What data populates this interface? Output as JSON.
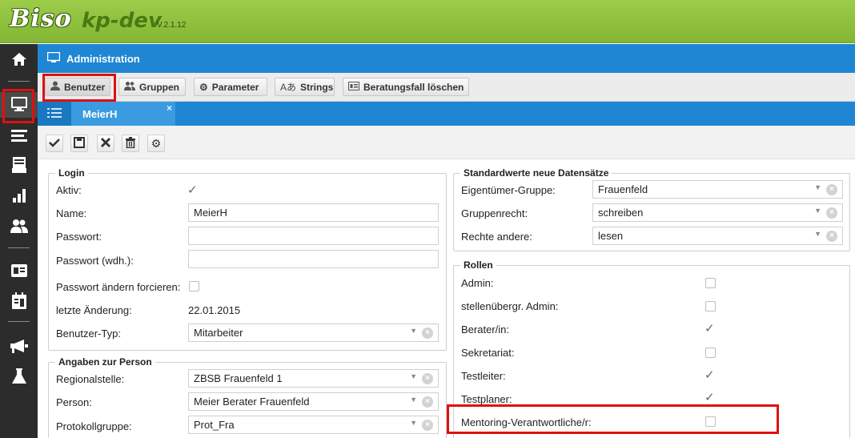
{
  "header": {
    "logo": "Biso",
    "app_name": "kp-dev",
    "version": "V.2.1.12"
  },
  "sidebar": {
    "items": [
      {
        "icon": "home-icon"
      },
      {
        "icon": "monitor-icon",
        "active": true
      },
      {
        "icon": "list-icon"
      },
      {
        "icon": "archive-icon"
      },
      {
        "icon": "bar-chart-icon"
      },
      {
        "icon": "users-icon"
      },
      {
        "icon": "id-card-icon"
      },
      {
        "icon": "calendar-icon"
      },
      {
        "icon": "megaphone-icon"
      },
      {
        "icon": "flask-icon"
      }
    ]
  },
  "admin_bar": {
    "title": "Administration"
  },
  "admin_toolbar": {
    "buttons": [
      {
        "label": "Benutzer",
        "icon": "user-icon",
        "active": true
      },
      {
        "label": "Gruppen",
        "icon": "group-icon"
      },
      {
        "label": "Parameter",
        "icon": "gear-icon"
      },
      {
        "label": "Strings",
        "icon": "translate-icon"
      },
      {
        "label": "Beratungsfall löschen",
        "icon": "card-icon"
      }
    ]
  },
  "tabs": [
    {
      "label": "MeierH",
      "close": "×"
    }
  ],
  "form_toolbar": {
    "buttons": [
      "save-check",
      "save-disk",
      "cancel",
      "delete",
      "settings"
    ]
  },
  "login": {
    "legend": "Login",
    "aktiv_label": "Aktiv:",
    "aktiv_checked": true,
    "name_label": "Name:",
    "name_value": "MeierH",
    "passwort_label": "Passwort:",
    "passwort_value": "",
    "passwort2_label": "Passwort (wdh.):",
    "passwort2_value": "",
    "forcieren_label": "Passwort ändern forcieren:",
    "forcieren_checked": false,
    "aenderung_label": "letzte Änderung:",
    "aenderung_value": "22.01.2015",
    "typ_label": "Benutzer-Typ:",
    "typ_value": "Mitarbeiter"
  },
  "person": {
    "legend": "Angaben zur Person",
    "regional_label": "Regionalstelle:",
    "regional_value": "ZBSB Frauenfeld 1",
    "person_label": "Person:",
    "person_value": "Meier Berater Frauenfeld",
    "protokoll_label": "Protokollgruppe:",
    "protokoll_value": "Prot_Fra"
  },
  "defaults": {
    "legend": "Standardwerte neue Datensätze",
    "eigentuemer_label": "Eigentümer-Gruppe:",
    "eigentuemer_value": "Frauenfeld",
    "gruppenrecht_label": "Gruppenrecht:",
    "gruppenrecht_value": "schreiben",
    "rechte_label": "Rechte andere:",
    "rechte_value": "lesen"
  },
  "rollen": {
    "legend": "Rollen",
    "items": [
      {
        "label": "Admin:",
        "checked": false
      },
      {
        "label": "stellenübergr. Admin:",
        "checked": false
      },
      {
        "label": "Berater/in:",
        "checked": true
      },
      {
        "label": "Sekretariat:",
        "checked": false
      },
      {
        "label": "Testleiter:",
        "checked": true
      },
      {
        "label": "Testplaner:",
        "checked": true
      },
      {
        "label": "Mentoring-Verantwortliche/r:",
        "checked": false
      }
    ]
  },
  "colors": {
    "header_green": "#8cc13d",
    "primary_blue": "#1f86d3",
    "highlight_red": "#e01010",
    "sidebar_dark": "#2c2c2c"
  }
}
